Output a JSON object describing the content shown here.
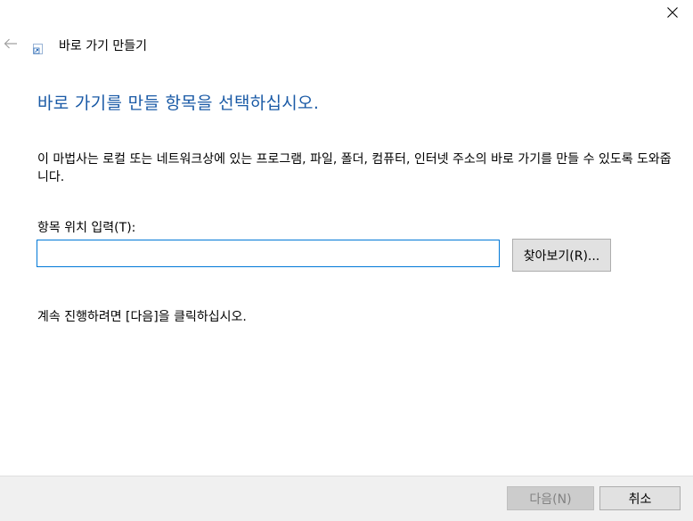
{
  "window": {
    "title": "바로 가기 만들기"
  },
  "main": {
    "instruction": "바로 가기를 만들 항목을 선택하십시오.",
    "description": "이 마법사는 로컬 또는 네트워크상에 있는 프로그램, 파일, 폴더, 컴퓨터, 인터넷 주소의 바로 가기를 만들 수 있도록 도와줍니다.",
    "field_label": "항목 위치 입력(T):",
    "location_value": "",
    "browse_label": "찾아보기(R)...",
    "continue_hint": "계속 진행하려면 [다음]을 클릭하십시오."
  },
  "footer": {
    "next_label": "다음(N)",
    "cancel_label": "취소"
  },
  "icons": {
    "close": "close-icon",
    "back": "back-arrow-icon",
    "app": "shortcut-icon"
  },
  "colors": {
    "instruction": "#1a5aa6",
    "input_focus_border": "#0078d7",
    "footer_bg": "#f0f0f0"
  }
}
